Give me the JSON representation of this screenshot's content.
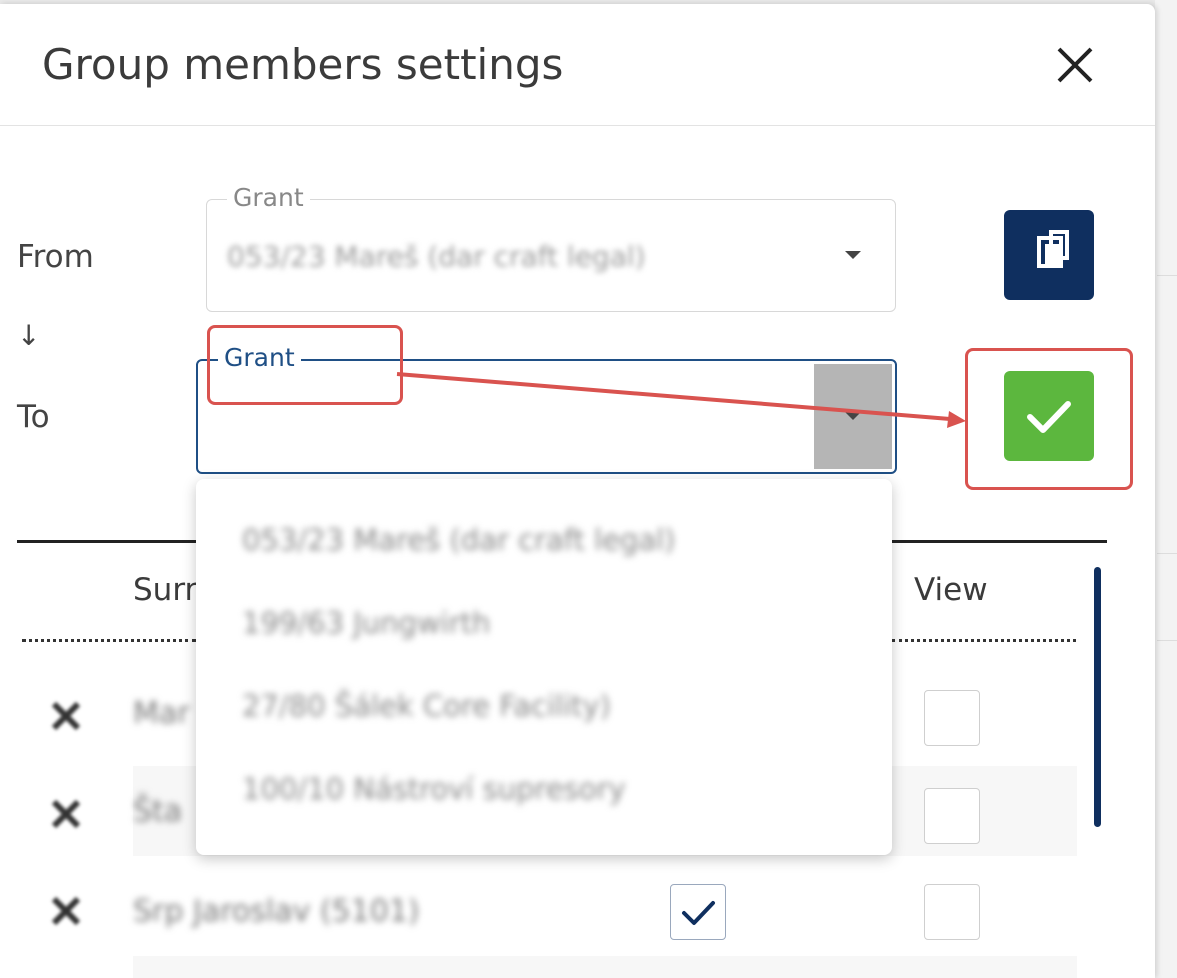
{
  "dialog": {
    "title": "Group members settings",
    "close_icon": "close-icon"
  },
  "from": {
    "label": "From",
    "field_legend": "Grant",
    "value": "053/23 Mareš (dar craft legal)"
  },
  "arrow_glyph": "↓",
  "to": {
    "label": "To",
    "field_legend": "Grant",
    "value": ""
  },
  "buttons": {
    "copy_icon": "copy-icon",
    "confirm_icon": "check-icon"
  },
  "table": {
    "columns": [
      "Surr",
      "View"
    ],
    "rows": [
      {
        "name": "Mar",
        "edit_checked": false,
        "view_checked": false
      },
      {
        "name": "Šta",
        "edit_checked": false,
        "view_checked": false
      },
      {
        "name": "Srp Jaroslav (5101)",
        "edit_checked": true,
        "view_checked": false
      }
    ]
  },
  "dropdown": {
    "options": [
      "053/23 Mareš (dar craft legal)",
      "199/63 Jungwirth",
      "27/80 Šálek Core Facility)",
      "100/10 Nástroví supresory"
    ]
  },
  "colors": {
    "primary": "#0f2f5f",
    "success": "#5cb73e",
    "annotation": "#d9534f",
    "focus_label": "#1f4f85"
  }
}
